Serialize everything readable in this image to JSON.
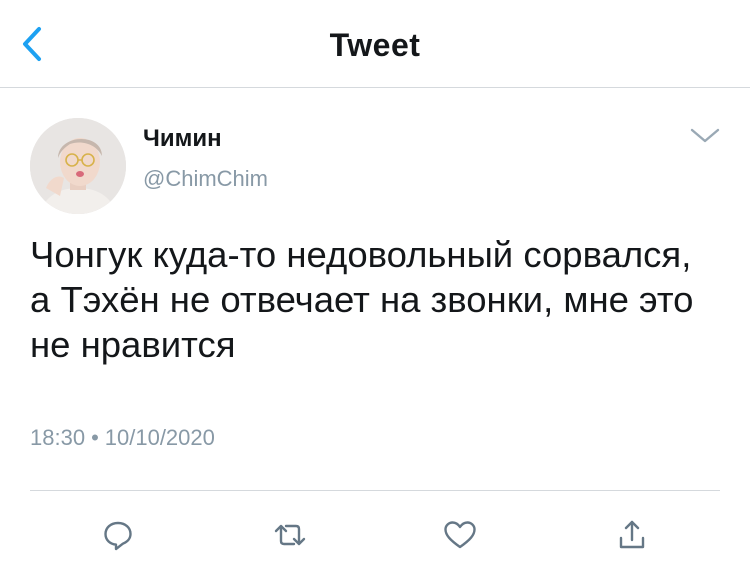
{
  "header": {
    "title": "Tweet",
    "back_icon": "chevron-left-icon",
    "accent": "#1da1f2"
  },
  "tweet": {
    "author_name": "Чимин",
    "author_handle": "@ChimChim",
    "text": "Чонгук куда-то недовольный сорвался, а Тэхён не отвечает на звонки, мне это не нравится",
    "time": "18:30",
    "separator": "•",
    "date": "10/10/2020",
    "menu_icon": "chevron-down-icon"
  },
  "actions": [
    {
      "name": "reply",
      "icon": "reply-icon"
    },
    {
      "name": "retweet",
      "icon": "retweet-icon"
    },
    {
      "name": "like",
      "icon": "heart-icon"
    },
    {
      "name": "share",
      "icon": "share-icon"
    }
  ],
  "colors": {
    "text": "#14171a",
    "secondary": "#8899a6",
    "icon_gray": "#657786",
    "divider": "#d5d9dd"
  }
}
